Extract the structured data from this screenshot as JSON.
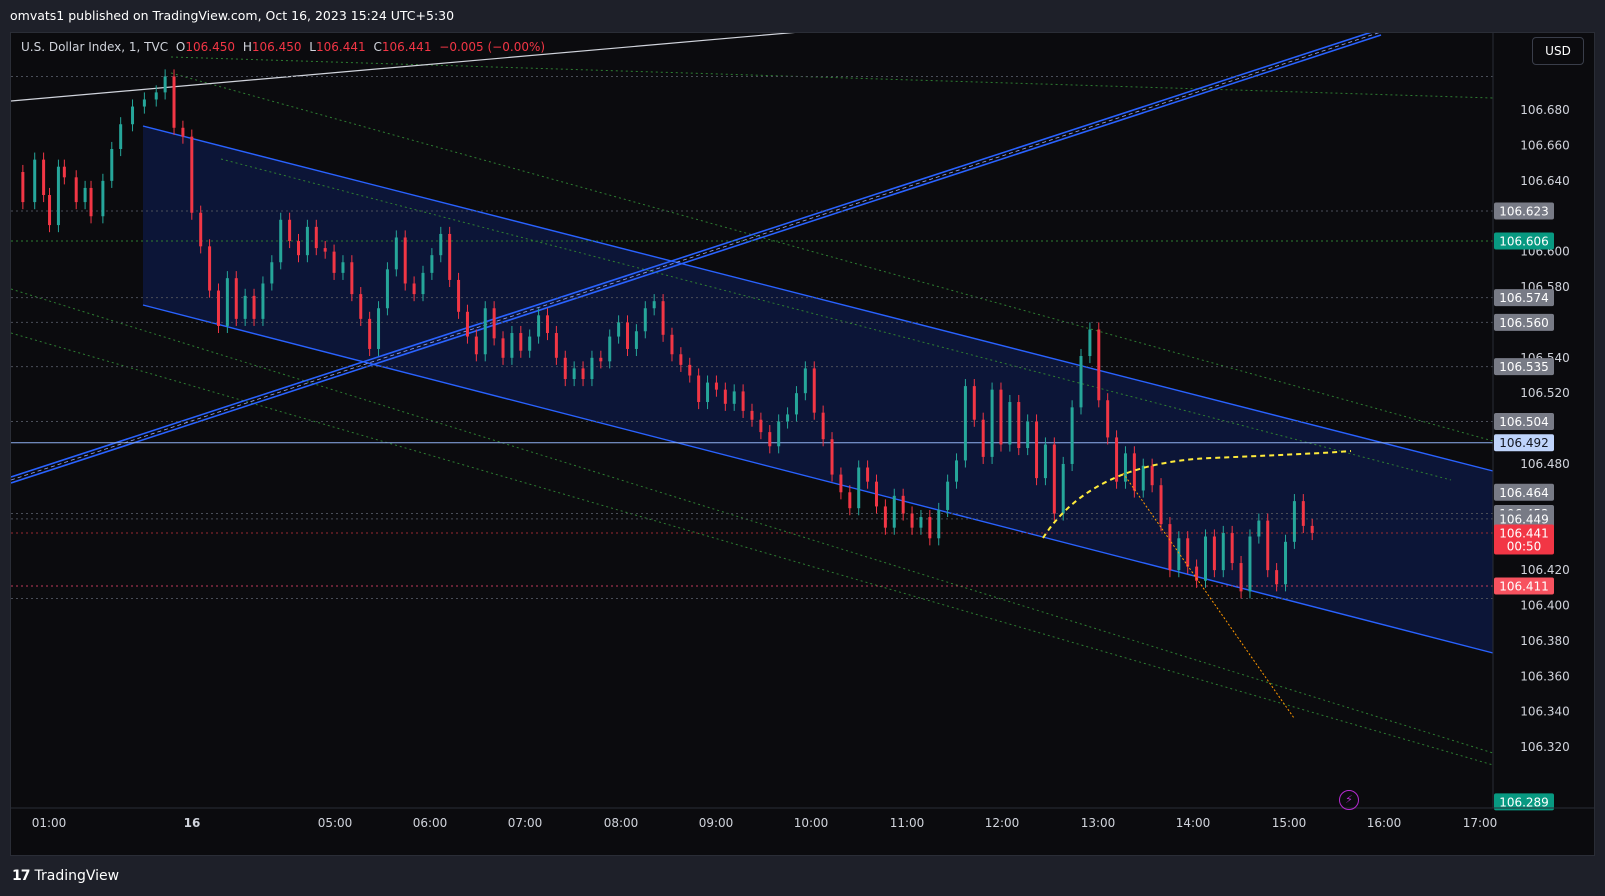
{
  "header": {
    "published_text": "omvats1 published on TradingView.com, Oct 16, 2023 15:24 UTC+5:30"
  },
  "legend": {
    "symbol": "U.S. Dollar Index",
    "interval": "1",
    "exchange": "TVC",
    "open_label": "O",
    "open": "106.450",
    "high_label": "H",
    "high": "106.450",
    "low_label": "L",
    "low": "106.441",
    "close_label": "C",
    "close": "106.441",
    "change": "−0.005 (−0.00%)"
  },
  "currency_button": "USD",
  "footer": {
    "brand": "TradingView",
    "brand_mark": "17"
  },
  "icons": {
    "lightning": "lightning-icon"
  },
  "colors": {
    "background": "#0b0b0e",
    "up_candle": "#26a69a",
    "down_candle": "#f23645",
    "channel_line": "#2962ff",
    "channel_fill": "#0d1a45",
    "price_tag_current": "#f23645",
    "price_tag_green": "#089981",
    "price_tag_pink": "#f7525f",
    "price_tag_blue": "#bfd4fb",
    "price_tag_gray": "#787b86",
    "arc": "#ffeb3b",
    "orange_line": "#ff9800"
  },
  "chart_data": {
    "type": "candlestick",
    "symbol": "U.S. Dollar Index",
    "timeframe": "1",
    "x_ticks": [
      "01:00",
      "16",
      "05:00",
      "06:00",
      "07:00",
      "08:00",
      "09:00",
      "10:00",
      "11:00",
      "12:00",
      "13:00",
      "14:00",
      "15:00",
      "16:00",
      "17:00"
    ],
    "y_ticks": [
      "106.680",
      "106.660",
      "106.640",
      "106.600",
      "106.580",
      "106.540",
      "106.520",
      "106.480",
      "106.420",
      "106.400",
      "106.380",
      "106.360",
      "106.340",
      "106.320"
    ],
    "y_range": [
      106.285,
      106.71
    ],
    "price_tags": [
      {
        "value": "106.623",
        "style": "gray"
      },
      {
        "value": "106.606",
        "style": "green"
      },
      {
        "value": "106.574",
        "style": "gray"
      },
      {
        "value": "106.560",
        "style": "gray"
      },
      {
        "value": "106.535",
        "style": "gray"
      },
      {
        "value": "106.504",
        "style": "gray"
      },
      {
        "value": "106.492",
        "style": "blue"
      },
      {
        "value": "106.464",
        "style": "gray"
      },
      {
        "value": "106.452",
        "style": "gray"
      },
      {
        "value": "106.449",
        "style": "gray"
      },
      {
        "value": "106.441",
        "style": "current",
        "countdown": "00:50"
      },
      {
        "value": "106.411",
        "style": "pink"
      },
      {
        "value": "106.289",
        "style": "green"
      }
    ],
    "horizontal_levels": [
      {
        "value": 106.699,
        "style": "dotted-gray"
      },
      {
        "value": 106.623,
        "style": "dotted-gray"
      },
      {
        "value": 106.606,
        "style": "dotted-green"
      },
      {
        "value": 106.574,
        "style": "dotted-gray"
      },
      {
        "value": 106.56,
        "style": "dotted-gray"
      },
      {
        "value": 106.535,
        "style": "dotted-gray"
      },
      {
        "value": 106.504,
        "style": "dotted-gray"
      },
      {
        "value": 106.492,
        "style": "solid-blue"
      },
      {
        "value": 106.452,
        "style": "dotted-gray"
      },
      {
        "value": 106.449,
        "style": "dotted-gray"
      },
      {
        "value": 106.441,
        "style": "dotted-red"
      },
      {
        "value": 106.411,
        "style": "dotted-pink"
      },
      {
        "value": 106.404,
        "style": "dotted-gray"
      }
    ],
    "price_path": [
      [
        0.0,
        106.645
      ],
      [
        0.8,
        106.628
      ],
      [
        1.6,
        106.652
      ],
      [
        2.2,
        106.632
      ],
      [
        2.6,
        106.615
      ],
      [
        3.2,
        106.648
      ],
      [
        3.6,
        106.642
      ],
      [
        4.4,
        106.628
      ],
      [
        5.0,
        106.636
      ],
      [
        5.4,
        106.62
      ],
      [
        6.2,
        106.64
      ],
      [
        6.8,
        106.658
      ],
      [
        7.4,
        106.672
      ],
      [
        8.2,
        106.682
      ],
      [
        9.0,
        106.686
      ],
      [
        9.8,
        106.69
      ],
      [
        10.4,
        106.699
      ],
      [
        11.0,
        106.67
      ],
      [
        11.6,
        106.665
      ],
      [
        12.2,
        106.622
      ],
      [
        12.8,
        106.603
      ],
      [
        13.4,
        106.578
      ],
      [
        14.0,
        106.558
      ],
      [
        14.6,
        106.585
      ],
      [
        15.2,
        106.562
      ],
      [
        15.8,
        106.575
      ],
      [
        16.4,
        106.562
      ],
      [
        17.0,
        106.582
      ],
      [
        17.6,
        106.594
      ],
      [
        18.2,
        106.618
      ],
      [
        18.8,
        106.606
      ],
      [
        19.4,
        106.598
      ],
      [
        20.0,
        106.614
      ],
      [
        20.6,
        106.602
      ],
      [
        21.2,
        106.6
      ],
      [
        21.8,
        106.588
      ],
      [
        22.4,
        106.594
      ],
      [
        23.0,
        106.576
      ],
      [
        23.6,
        106.562
      ],
      [
        24.2,
        106.545
      ],
      [
        24.8,
        106.568
      ],
      [
        25.4,
        106.59
      ],
      [
        26.0,
        106.608
      ],
      [
        26.6,
        106.582
      ],
      [
        27.2,
        106.576
      ],
      [
        27.8,
        106.588
      ],
      [
        28.4,
        106.598
      ],
      [
        29.0,
        106.61
      ],
      [
        29.6,
        106.584
      ],
      [
        30.2,
        106.566
      ],
      [
        30.8,
        106.552
      ],
      [
        31.4,
        106.542
      ],
      [
        32.0,
        106.568
      ],
      [
        32.6,
        106.551
      ],
      [
        33.2,
        106.54
      ],
      [
        33.8,
        106.554
      ],
      [
        34.4,
        106.544
      ],
      [
        35.0,
        106.552
      ],
      [
        35.6,
        106.564
      ],
      [
        36.2,
        106.554
      ],
      [
        36.8,
        106.54
      ],
      [
        37.4,
        106.528
      ],
      [
        38.0,
        106.534
      ],
      [
        38.6,
        106.528
      ],
      [
        39.2,
        106.54
      ],
      [
        39.8,
        106.538
      ],
      [
        40.4,
        106.552
      ],
      [
        41.0,
        106.56
      ],
      [
        41.6,
        106.545
      ],
      [
        42.2,
        106.555
      ],
      [
        42.8,
        106.568
      ],
      [
        43.4,
        106.572
      ],
      [
        44.0,
        106.553
      ],
      [
        44.6,
        106.542
      ],
      [
        45.2,
        106.536
      ],
      [
        45.8,
        106.53
      ],
      [
        46.4,
        106.515
      ],
      [
        47.0,
        106.526
      ],
      [
        47.6,
        106.522
      ],
      [
        48.2,
        106.514
      ],
      [
        48.8,
        106.521
      ],
      [
        49.4,
        106.51
      ],
      [
        50.0,
        106.505
      ],
      [
        50.6,
        106.498
      ],
      [
        51.2,
        106.49
      ],
      [
        51.8,
        106.504
      ],
      [
        52.4,
        106.508
      ],
      [
        53.0,
        106.52
      ],
      [
        53.6,
        106.534
      ],
      [
        54.2,
        106.509
      ],
      [
        54.8,
        106.494
      ],
      [
        55.4,
        106.474
      ],
      [
        56.0,
        106.464
      ],
      [
        56.6,
        106.455
      ],
      [
        57.2,
        106.478
      ],
      [
        57.8,
        106.47
      ],
      [
        58.4,
        106.456
      ],
      [
        59.0,
        106.444
      ],
      [
        59.6,
        106.462
      ],
      [
        60.2,
        106.452
      ],
      [
        60.8,
        106.444
      ],
      [
        61.4,
        106.45
      ],
      [
        62.0,
        106.438
      ],
      [
        62.6,
        106.454
      ],
      [
        63.2,
        106.47
      ],
      [
        63.8,
        106.482
      ],
      [
        64.4,
        106.524
      ],
      [
        65.0,
        106.505
      ],
      [
        65.6,
        106.484
      ],
      [
        66.2,
        106.522
      ],
      [
        66.8,
        106.491
      ],
      [
        67.4,
        106.515
      ],
      [
        68.0,
        106.489
      ],
      [
        68.6,
        106.504
      ],
      [
        69.2,
        106.472
      ],
      [
        69.8,
        106.491
      ],
      [
        70.4,
        106.452
      ],
      [
        71.0,
        106.48
      ],
      [
        71.6,
        106.512
      ],
      [
        72.2,
        106.541
      ],
      [
        72.8,
        106.556
      ],
      [
        73.4,
        106.516
      ],
      [
        74.0,
        106.495
      ],
      [
        74.6,
        106.47
      ],
      [
        75.2,
        106.486
      ],
      [
        75.8,
        106.465
      ],
      [
        76.4,
        106.479
      ],
      [
        77.0,
        106.468
      ],
      [
        77.6,
        106.446
      ],
      [
        78.2,
        106.42
      ],
      [
        78.8,
        106.438
      ],
      [
        79.4,
        106.422
      ],
      [
        80.0,
        106.414
      ],
      [
        80.6,
        106.439
      ],
      [
        81.2,
        106.42
      ],
      [
        81.8,
        106.441
      ],
      [
        82.4,
        106.424
      ],
      [
        83.0,
        106.408
      ],
      [
        83.6,
        106.439
      ],
      [
        84.2,
        106.448
      ],
      [
        84.8,
        106.42
      ],
      [
        85.4,
        106.412
      ],
      [
        86.0,
        106.436
      ],
      [
        86.6,
        106.459
      ],
      [
        87.2,
        106.445
      ],
      [
        87.8,
        106.441
      ]
    ],
    "x_span": [
      0,
      100
    ]
  }
}
